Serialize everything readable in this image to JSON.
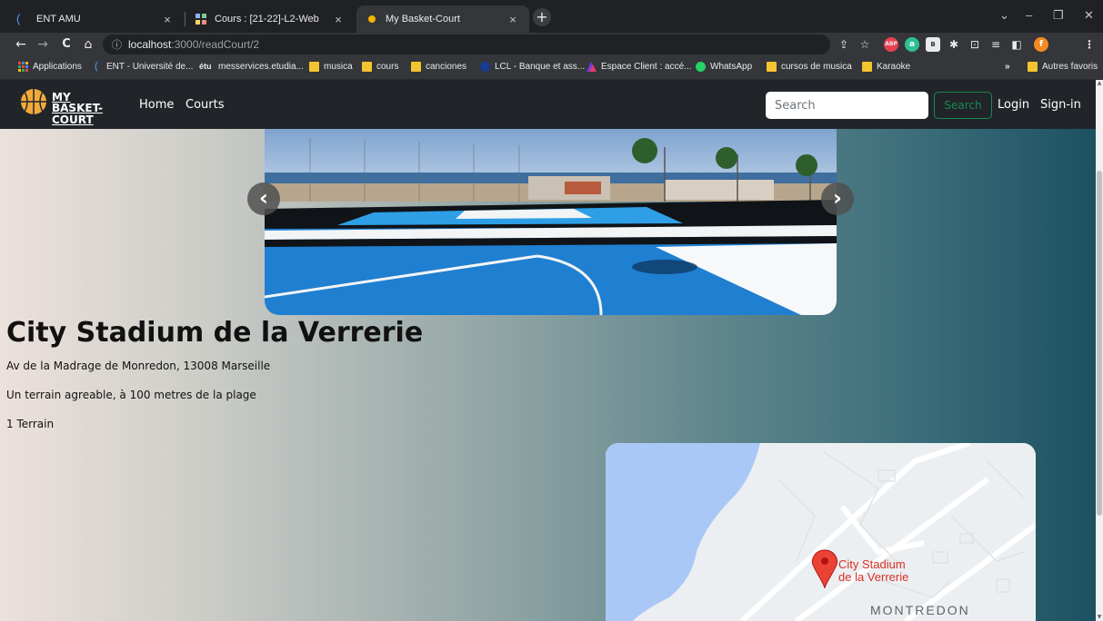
{
  "browser": {
    "tabs": [
      {
        "title": "ENT AMU",
        "close": "×"
      },
      {
        "title": "Cours : [21-22]-L2-Web",
        "close": "×"
      },
      {
        "title": "My Basket-Court",
        "close": "×"
      }
    ],
    "new_tab": "+",
    "window_controls": {
      "chevron": "⌄",
      "minimize": "–",
      "restore": "❐",
      "close": "✕"
    },
    "nav": {
      "back": "←",
      "forward": "→",
      "reload": "C",
      "home": "⌂"
    },
    "url": {
      "info_glyph": "ⓘ",
      "host": "localhost",
      "path": ":3000/readCourt/2"
    },
    "toolbar_icons": {
      "share": "⇪",
      "star": "☆",
      "abp": "ABP",
      "a": "a",
      "b": "B",
      "puzzle": "✱",
      "cast": "⊡",
      "list": "≡",
      "sidepanel": "◧",
      "profile": "f",
      "menu": "⋮"
    },
    "bookmarks": [
      {
        "label": "Applications"
      },
      {
        "label": "ENT - Université de..."
      },
      {
        "label": "messervices.etudia..."
      },
      {
        "label": "musica"
      },
      {
        "label": "cours"
      },
      {
        "label": "canciones"
      },
      {
        "label": "LCL - Banque et ass..."
      },
      {
        "label": "Espace Client : accé..."
      },
      {
        "label": "WhatsApp"
      },
      {
        "label": "cursos de musica"
      },
      {
        "label": "Karaoke"
      }
    ],
    "bookmark_overflow": "»",
    "other_bookmarks": "Autres favoris"
  },
  "site": {
    "brand_line1": "MY BASKET-",
    "brand_line2": "COURT",
    "nav": {
      "home": "Home",
      "courts": "Courts"
    },
    "search_placeholder": "Search",
    "search_button": "Search",
    "login": "Login",
    "signin": "Sign-in"
  },
  "carousel": {
    "prev": "‹",
    "next": "›"
  },
  "court": {
    "name": "City Stadium de la Verrerie",
    "address": "Av de la Madrage de Monredon, 13008 Marseille",
    "description": "Un terrain agreable, à 100 metres de la plage",
    "terrains": "1 Terrain"
  },
  "map": {
    "pin_label_line1": "City Stadium",
    "pin_label_line2": "de la Verrerie",
    "area_label": "MONTREDON"
  },
  "colors": {
    "navbar": "#212529",
    "search_button": "#198754",
    "map_pin": "#d93025",
    "water": "#aac8f6"
  }
}
